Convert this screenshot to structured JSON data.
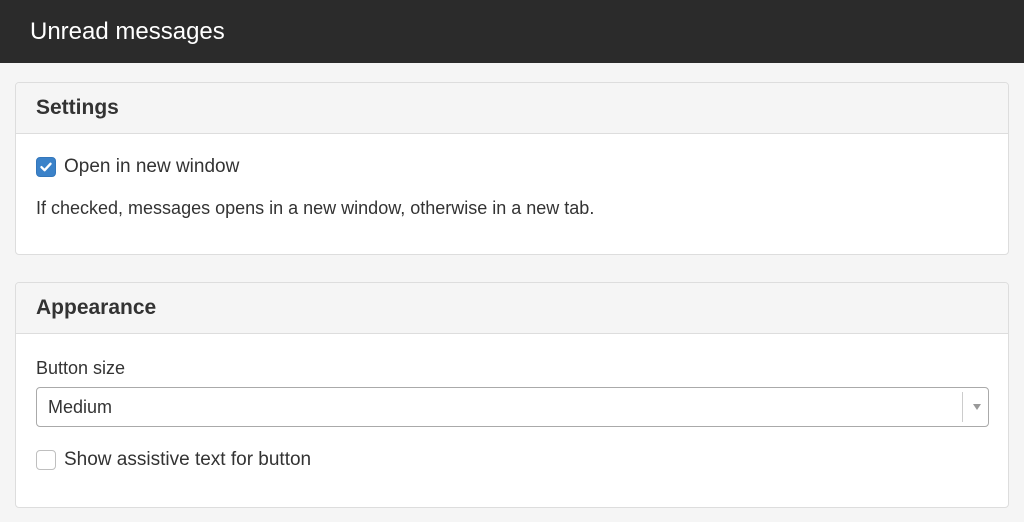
{
  "header": {
    "title": "Unread messages"
  },
  "settings": {
    "heading": "Settings",
    "open_new_window": {
      "label": "Open in new window",
      "checked": true
    },
    "help_text": "If checked, messages opens in a new window, otherwise in a new tab."
  },
  "appearance": {
    "heading": "Appearance",
    "button_size": {
      "label": "Button size",
      "selected": "Medium"
    },
    "assistive_text": {
      "label": "Show assistive text for button",
      "checked": false
    }
  },
  "colors": {
    "topbar": "#2b2b2b",
    "checkbox_accent": "#3b82c9",
    "page_background": "#f5f5f5"
  }
}
